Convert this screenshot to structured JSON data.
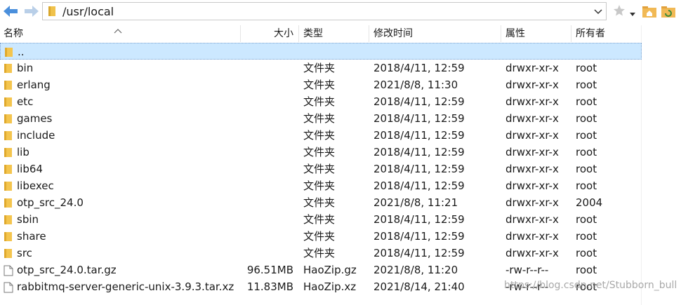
{
  "toolbar": {
    "path": "/usr/local",
    "icons": [
      "back-arrow-icon",
      "forward-arrow-icon",
      "folder-icon",
      "chevron-down-icon",
      "star-icon",
      "dropdown-arrow-icon",
      "home-folder-icon",
      "refresh-icon"
    ]
  },
  "columns": {
    "name": "名称",
    "size": "大小",
    "type": "类型",
    "modified": "修改时间",
    "attributes": "属性",
    "owner": "所有者"
  },
  "rows": [
    {
      "name": "..",
      "size": "",
      "type": "",
      "modified": "",
      "attributes": "",
      "owner": "",
      "icon": "folder-icon",
      "selected": true
    },
    {
      "name": "bin",
      "size": "",
      "type": "文件夹",
      "modified": "2018/4/11, 12:59",
      "attributes": "drwxr-xr-x",
      "owner": "root",
      "icon": "folder-icon"
    },
    {
      "name": "erlang",
      "size": "",
      "type": "文件夹",
      "modified": "2021/8/8, 11:30",
      "attributes": "drwxr-xr-x",
      "owner": "root",
      "icon": "folder-icon"
    },
    {
      "name": "etc",
      "size": "",
      "type": "文件夹",
      "modified": "2018/4/11, 12:59",
      "attributes": "drwxr-xr-x",
      "owner": "root",
      "icon": "folder-icon"
    },
    {
      "name": "games",
      "size": "",
      "type": "文件夹",
      "modified": "2018/4/11, 12:59",
      "attributes": "drwxr-xr-x",
      "owner": "root",
      "icon": "folder-icon"
    },
    {
      "name": "include",
      "size": "",
      "type": "文件夹",
      "modified": "2018/4/11, 12:59",
      "attributes": "drwxr-xr-x",
      "owner": "root",
      "icon": "folder-icon"
    },
    {
      "name": "lib",
      "size": "",
      "type": "文件夹",
      "modified": "2018/4/11, 12:59",
      "attributes": "drwxr-xr-x",
      "owner": "root",
      "icon": "folder-icon"
    },
    {
      "name": "lib64",
      "size": "",
      "type": "文件夹",
      "modified": "2018/4/11, 12:59",
      "attributes": "drwxr-xr-x",
      "owner": "root",
      "icon": "folder-icon"
    },
    {
      "name": "libexec",
      "size": "",
      "type": "文件夹",
      "modified": "2018/4/11, 12:59",
      "attributes": "drwxr-xr-x",
      "owner": "root",
      "icon": "folder-icon"
    },
    {
      "name": "otp_src_24.0",
      "size": "",
      "type": "文件夹",
      "modified": "2021/8/8, 11:21",
      "attributes": "drwxr-xr-x",
      "owner": "2004",
      "icon": "folder-icon"
    },
    {
      "name": "sbin",
      "size": "",
      "type": "文件夹",
      "modified": "2018/4/11, 12:59",
      "attributes": "drwxr-xr-x",
      "owner": "root",
      "icon": "folder-icon"
    },
    {
      "name": "share",
      "size": "",
      "type": "文件夹",
      "modified": "2018/4/11, 12:59",
      "attributes": "drwxr-xr-x",
      "owner": "root",
      "icon": "folder-icon"
    },
    {
      "name": "src",
      "size": "",
      "type": "文件夹",
      "modified": "2018/4/11, 12:59",
      "attributes": "drwxr-xr-x",
      "owner": "root",
      "icon": "folder-icon"
    },
    {
      "name": "otp_src_24.0.tar.gz",
      "size": "96.51MB",
      "type": "HaoZip.gz",
      "modified": "2021/8/8, 11:20",
      "attributes": "-rw-r--r--",
      "owner": "root",
      "icon": "file-icon"
    },
    {
      "name": "rabbitmq-server-generic-unix-3.9.3.tar.xz",
      "size": "11.83MB",
      "type": "HaoZip.xz",
      "modified": "2021/8/14, 21:40",
      "attributes": "-rw-r--r--",
      "owner": "root",
      "icon": "file-icon"
    }
  ],
  "watermark": "https://blog.csdn.net/Stubborn_bull",
  "colors": {
    "selection": "#cce8ff",
    "folder": "#f8d775",
    "accent": "#3b7ddd"
  }
}
